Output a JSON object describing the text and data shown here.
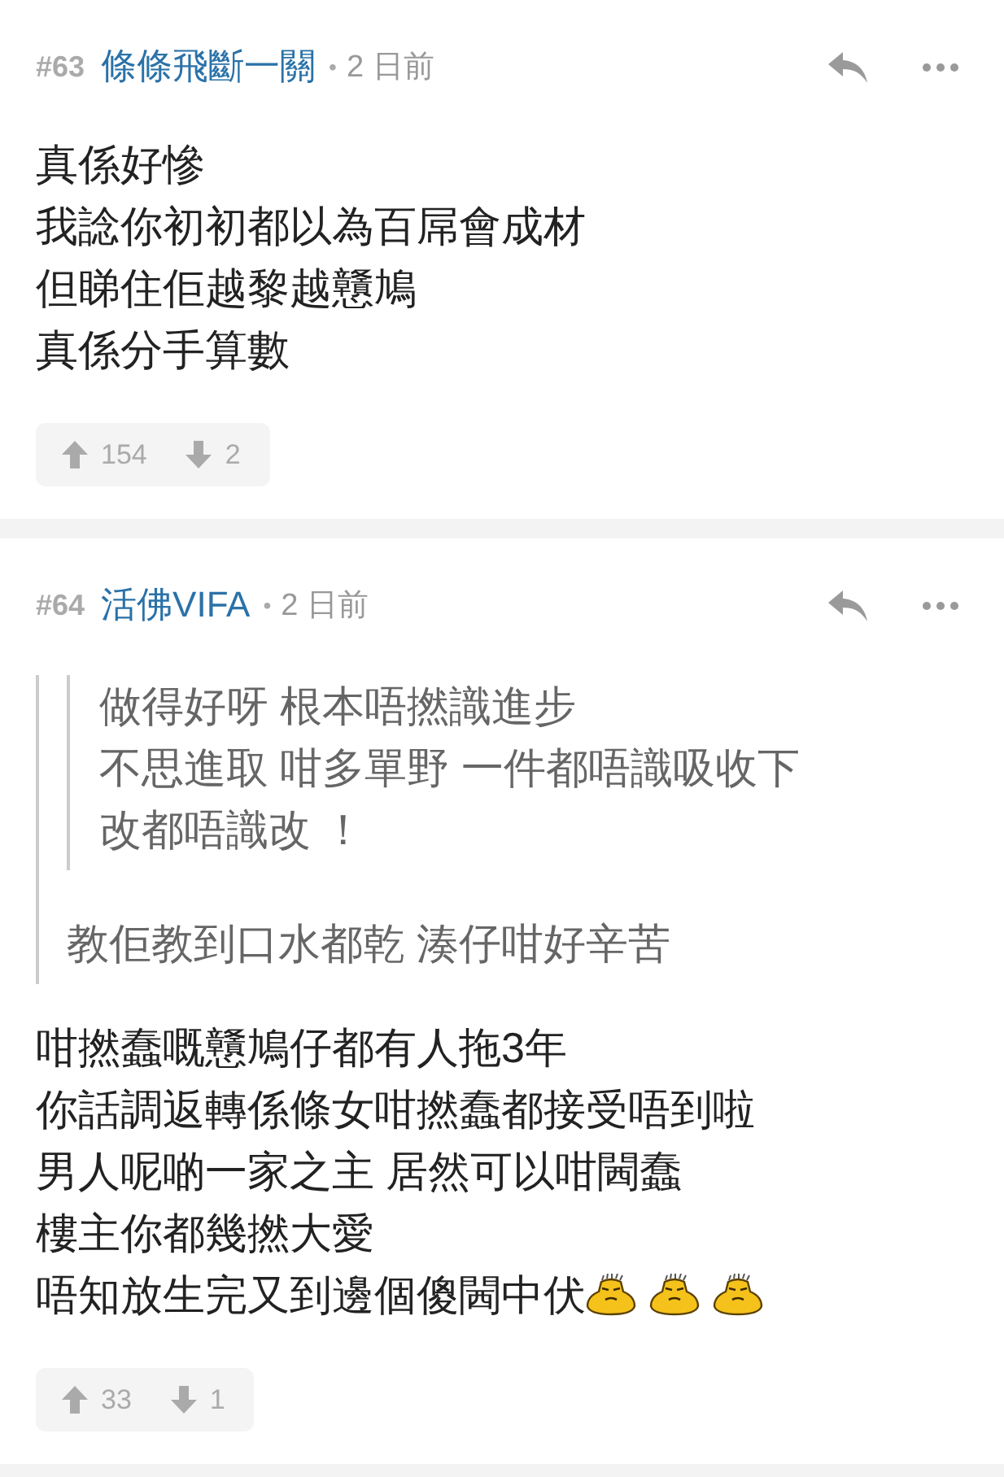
{
  "posts": [
    {
      "number": "#63",
      "username": "條條飛斷一關",
      "separator": "•",
      "time": "2 日前",
      "body": [
        {
          "text": "真係好慘"
        },
        {
          "text": "我諗你初初都以為百屌會成材"
        },
        {
          "text": "但睇住佢越黎越戇鳩"
        },
        {
          "text": "真係分手算數"
        }
      ],
      "votes": {
        "up": "154",
        "down": "2"
      }
    },
    {
      "number": "#64",
      "username": "活佛VIFA",
      "separator": "•",
      "time": "2 日前",
      "quote": {
        "quote": {
          "lines": [
            "做得好呀 根本唔撚識進步",
            "不思進取 咁多單野 一件都唔識吸收下",
            "改都唔識改 ！"
          ]
        },
        "lines": [
          "教佢教到口水都乾 湊仔咁好辛苦"
        ]
      },
      "body": [
        {
          "text": "咁撚蠢嘅戇鳩仔都有人拖3年"
        },
        {
          "text": "你話調返轉係條女咁撚蠢都接受唔到啦"
        },
        {
          "text": "男人呢啲一家之主 居然可以咁閪蠢"
        },
        {
          "text": "樓主你都幾撚大愛"
        },
        {
          "text": "唔知放生完又到邊個傻閪中伏",
          "emojis": [
            {
              "kind": "face"
            },
            {
              "kind": "face"
            },
            {
              "kind": "face"
            }
          ]
        }
      ],
      "votes": {
        "up": "33",
        "down": "1"
      }
    }
  ]
}
